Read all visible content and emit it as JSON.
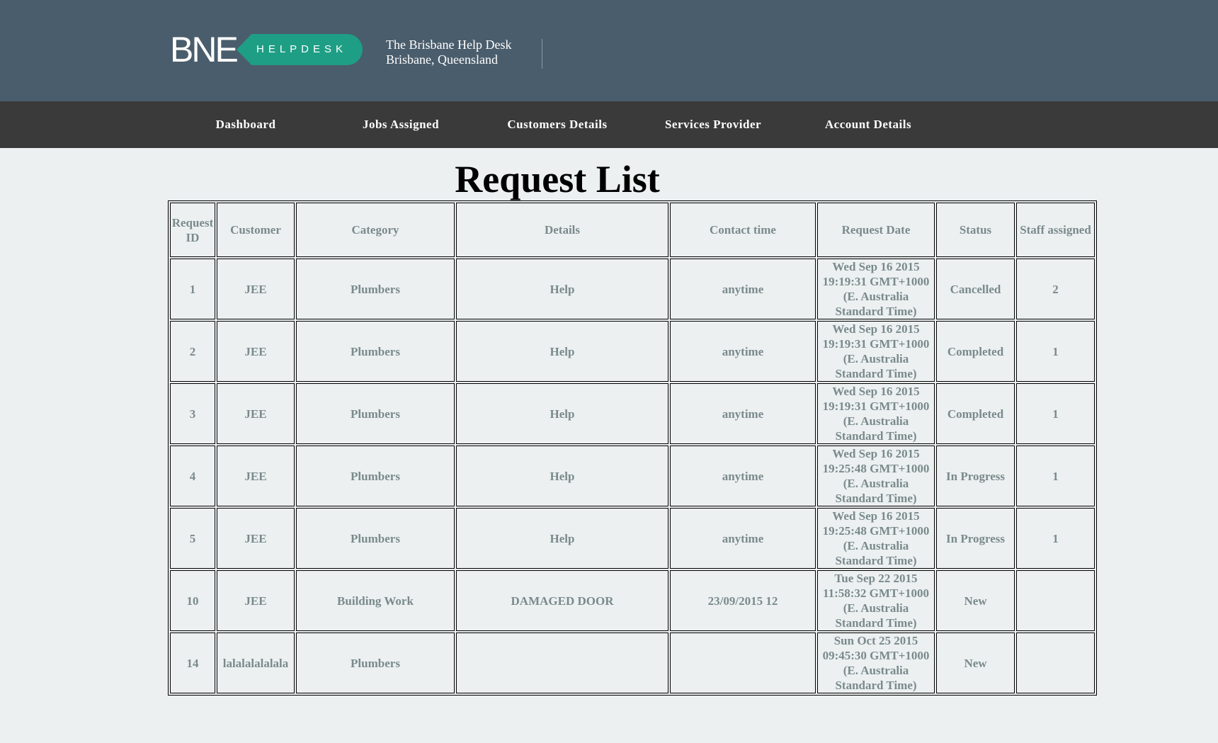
{
  "header": {
    "logo_text": "BNE",
    "logo_badge": "HELPDESK",
    "site_name": "The Brisbane Help Desk",
    "site_location": "Brisbane, Queensland"
  },
  "nav": {
    "items": [
      {
        "label": "Dashboard"
      },
      {
        "label": "Jobs Assigned"
      },
      {
        "label": "Customers Details"
      },
      {
        "label": "Services Provider"
      },
      {
        "label": "Account Details"
      }
    ]
  },
  "page": {
    "title": "Request List"
  },
  "table": {
    "columns": [
      "Request ID",
      "Customer",
      "Category",
      "Details",
      "Contact time",
      "Request Date",
      "Status",
      "Staff assigned"
    ],
    "rows": [
      {
        "id": "1",
        "customer": "JEE",
        "category": "Plumbers",
        "details": "Help",
        "contact": "anytime",
        "date": "Wed Sep 16 2015 19:19:31 GMT+1000 (E. Australia Standard Time)",
        "status": "Cancelled",
        "staff": "2"
      },
      {
        "id": "2",
        "customer": "JEE",
        "category": "Plumbers",
        "details": "Help",
        "contact": "anytime",
        "date": "Wed Sep 16 2015 19:19:31 GMT+1000 (E. Australia Standard Time)",
        "status": "Completed",
        "staff": "1"
      },
      {
        "id": "3",
        "customer": "JEE",
        "category": "Plumbers",
        "details": "Help",
        "contact": "anytime",
        "date": "Wed Sep 16 2015 19:19:31 GMT+1000 (E. Australia Standard Time)",
        "status": "Completed",
        "staff": "1"
      },
      {
        "id": "4",
        "customer": "JEE",
        "category": "Plumbers",
        "details": "Help",
        "contact": "anytime",
        "date": "Wed Sep 16 2015 19:25:48 GMT+1000 (E. Australia Standard Time)",
        "status": "In Progress",
        "staff": "1"
      },
      {
        "id": "5",
        "customer": "JEE",
        "category": "Plumbers",
        "details": "Help",
        "contact": "anytime",
        "date": "Wed Sep 16 2015 19:25:48 GMT+1000 (E. Australia Standard Time)",
        "status": "In Progress",
        "staff": "1"
      },
      {
        "id": "10",
        "customer": "JEE",
        "category": "Building Work",
        "details": "DAMAGED DOOR",
        "contact": "23/09/2015 12",
        "date": "Tue Sep 22 2015 11:58:32 GMT+1000 (E. Australia Standard Time)",
        "status": "New",
        "staff": ""
      },
      {
        "id": "14",
        "customer": "lalalalalalala",
        "category": "Plumbers",
        "details": "",
        "contact": "",
        "date": "Sun Oct 25 2015 09:45:30 GMT+1000 (E. Australia Standard Time)",
        "status": "New",
        "staff": ""
      }
    ]
  },
  "colors": {
    "header_bg": "#4a5d6c",
    "nav_bg": "#3a3a3a",
    "page_bg": "#ecf0f1",
    "badge": "#1e9e85",
    "cell_text": "#7a8a8c"
  }
}
